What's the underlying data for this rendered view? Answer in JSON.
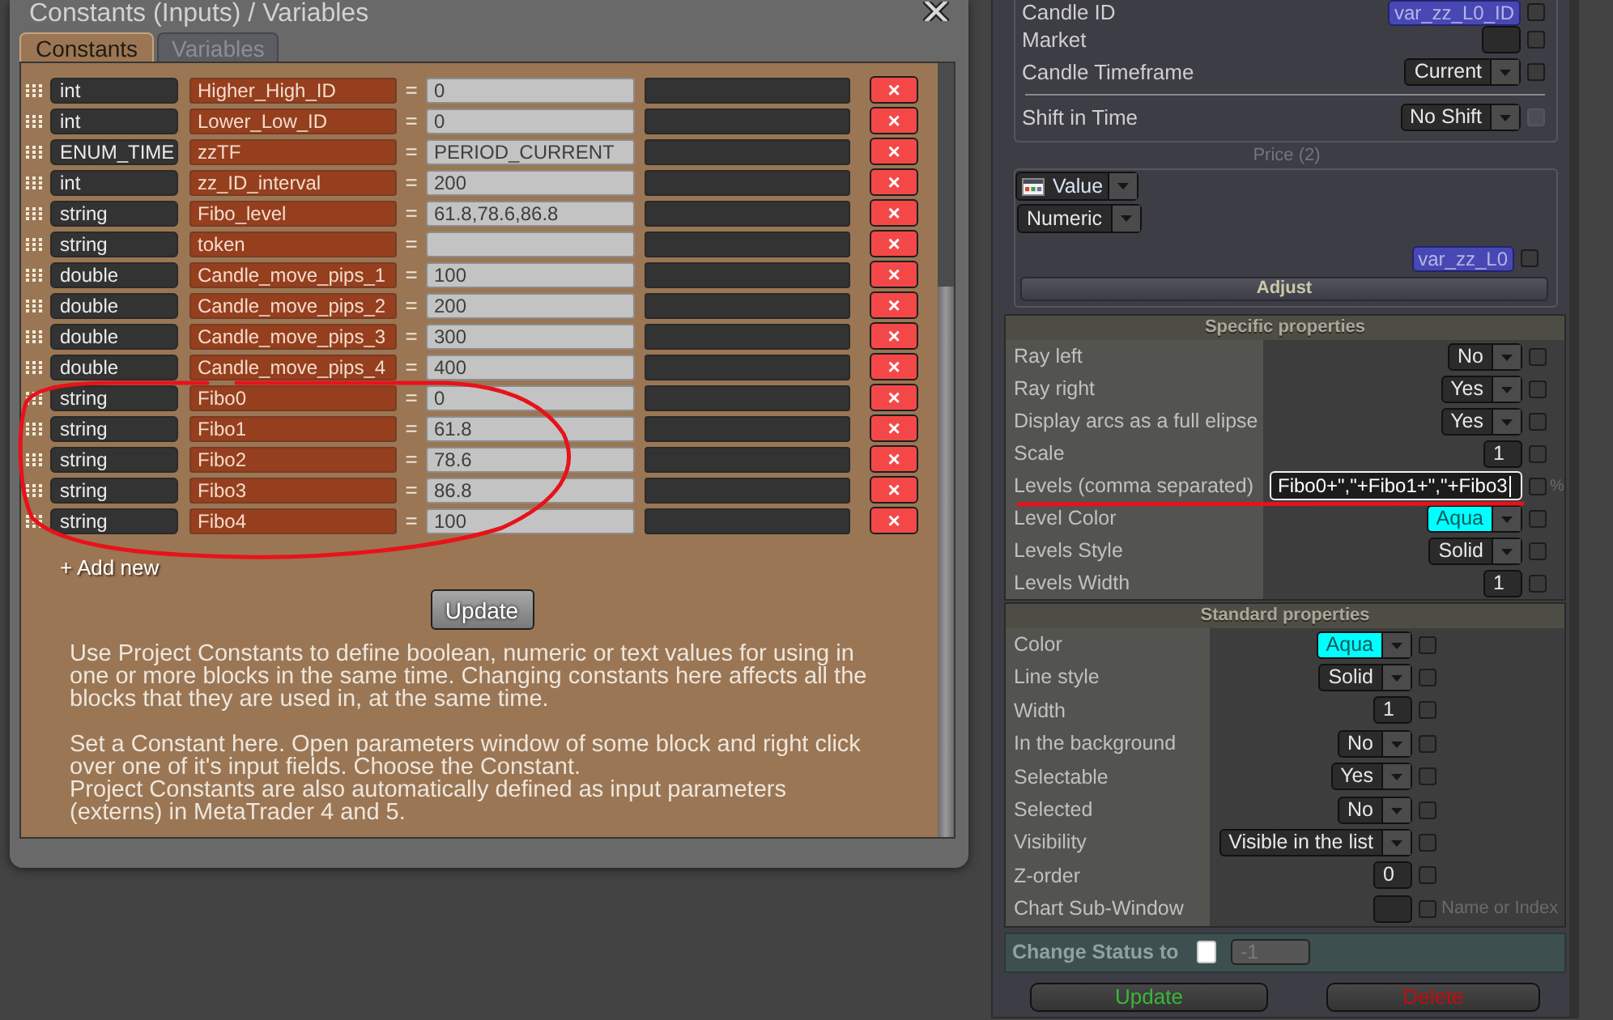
{
  "constants_window": {
    "title": "Constants (Inputs) / Variables",
    "tabs": [
      {
        "label": "Constants",
        "selected": true
      },
      {
        "label": "Variables",
        "selected": false
      }
    ],
    "constants": [
      {
        "type": "int",
        "name": "Higher_High_ID",
        "equals": "=",
        "value": "0",
        "delete": "×"
      },
      {
        "type": "int",
        "name": "Lower_Low_ID",
        "equals": "=",
        "value": "0",
        "delete": "×"
      },
      {
        "type": "ENUM_TIME",
        "name": "zzTF",
        "equals": "=",
        "value": "PERIOD_CURRENT",
        "delete": "×"
      },
      {
        "type": "int",
        "name": "zz_ID_interval",
        "equals": "=",
        "value": "200",
        "delete": "×"
      },
      {
        "type": "string",
        "name": "Fibo_level",
        "equals": "=",
        "value": "61.8,78.6,86.8",
        "delete": "×"
      },
      {
        "type": "string",
        "name": "token",
        "equals": "=",
        "delete": "×"
      },
      {
        "type": "double",
        "name": "Candle_move_pips_1",
        "equals": "=",
        "value": "100",
        "delete": "×"
      },
      {
        "type": "double",
        "name": "Candle_move_pips_2",
        "equals": "=",
        "value": "200",
        "delete": "×"
      },
      {
        "type": "double",
        "name": "Candle_move_pips_3",
        "equals": "=",
        "value": "300",
        "delete": "×"
      },
      {
        "type": "double",
        "name": "Candle_move_pips_4",
        "equals": "=",
        "value": "400",
        "delete": "×"
      },
      {
        "type": "string",
        "name": "Fibo0",
        "equals": "=",
        "value": "0",
        "delete": "×"
      },
      {
        "type": "string",
        "name": "Fibo1",
        "equals": "=",
        "value": "61.8",
        "delete": "×"
      },
      {
        "type": "string",
        "name": "Fibo2",
        "equals": "=",
        "value": "78.6",
        "delete": "×"
      },
      {
        "type": "string",
        "name": "Fibo3",
        "equals": "=",
        "value": "86.8",
        "delete": "×"
      },
      {
        "type": "string",
        "name": "Fibo4",
        "equals": "=",
        "value": "100",
        "delete": "×"
      }
    ],
    "add_new": "+ Add new",
    "update_button": "Update",
    "help_blocks": [
      [
        "Use Project Constants to define boolean, numeric or text values for using in one or more blocks in the same time. Changing constants here affects all the blocks that they are used in, at the same time."
      ],
      [
        "Set a Constant here. Open parameters window of some block and right click over one of it's input fields. Choose the Constant.",
        "Project Constants are also automatically defined as input parameters (externs) in MetaTrader 4 and 5."
      ]
    ]
  },
  "properties_panel": {
    "source": {
      "rows": [
        {
          "kind": "variable",
          "label": "Candle ID",
          "value": "var_zz_L0_ID",
          "checked": false,
          "disabled": false,
          "divider_above": false
        },
        {
          "kind": "field",
          "label": "Market",
          "checked": false,
          "disabled": false,
          "divider_above": false
        },
        {
          "kind": "dropdown",
          "label": "Candle Timeframe",
          "value": "Current",
          "checked": false,
          "disabled": false,
          "divider_above": false
        },
        {
          "kind": "dropdown",
          "label": "Shift in Time",
          "value": "No Shift",
          "checked": false,
          "disabled": true,
          "divider_above": true
        }
      ]
    },
    "price": {
      "caption": "Price (2)",
      "source_dropdown": "Value",
      "type_dropdown": "Numeric",
      "variable": "var_zz_L0",
      "checked": false,
      "adjust_button": "Adjust"
    },
    "specific_properties": {
      "title": "Specific properties",
      "rows": [
        {
          "kind": "dropdown",
          "label": "Ray left",
          "value": "No",
          "checked": false
        },
        {
          "kind": "dropdown",
          "label": "Ray right",
          "value": "Yes",
          "checked": false
        },
        {
          "kind": "dropdown",
          "label": "Display arcs as a full elipse",
          "value": "Yes",
          "checked": false
        },
        {
          "kind": "field",
          "label": "Scale",
          "value": "1",
          "checked": false
        },
        {
          "kind": "text",
          "label": "Levels (comma separated)",
          "value": "Fibo0+\",\"+Fibo1+\",\"+Fibo3",
          "focused": true,
          "checked": false,
          "note": "%"
        },
        {
          "kind": "dropdown",
          "label": "Level Color",
          "value": "Aqua",
          "color": "#00ffff",
          "checked": false
        },
        {
          "kind": "dropdown",
          "label": "Levels Style",
          "value": "Solid",
          "checked": false
        },
        {
          "kind": "field",
          "label": "Levels Width",
          "value": "1",
          "checked": false
        }
      ]
    },
    "standard_properties": {
      "title": "Standard properties",
      "rows": [
        {
          "kind": "dropdown",
          "label": "Color",
          "value": "Aqua",
          "color": "#00ffff",
          "checked": false
        },
        {
          "kind": "dropdown",
          "label": "Line style",
          "value": "Solid",
          "checked": false
        },
        {
          "kind": "field",
          "label": "Width",
          "value": "1",
          "checked": false
        },
        {
          "kind": "dropdown",
          "label": "In the background",
          "value": "No",
          "checked": false
        },
        {
          "kind": "dropdown",
          "label": "Selectable",
          "value": "Yes",
          "checked": false
        },
        {
          "kind": "dropdown",
          "label": "Selected",
          "value": "No",
          "checked": false
        },
        {
          "kind": "dropdown",
          "label": "Visibility",
          "value": "Visible in the list",
          "checked": false
        },
        {
          "kind": "field",
          "label": "Z-order",
          "value": "0",
          "checked": false
        },
        {
          "kind": "field",
          "label": "Chart Sub-Window",
          "checked": false,
          "note": "Name or Index"
        }
      ]
    },
    "change_status": {
      "label": "Change Status to",
      "checked": false,
      "value": "-1",
      "disabled": true
    },
    "buttons": [
      {
        "kind": "update",
        "label": "Update"
      },
      {
        "kind": "delete",
        "label": "Delete"
      }
    ]
  }
}
